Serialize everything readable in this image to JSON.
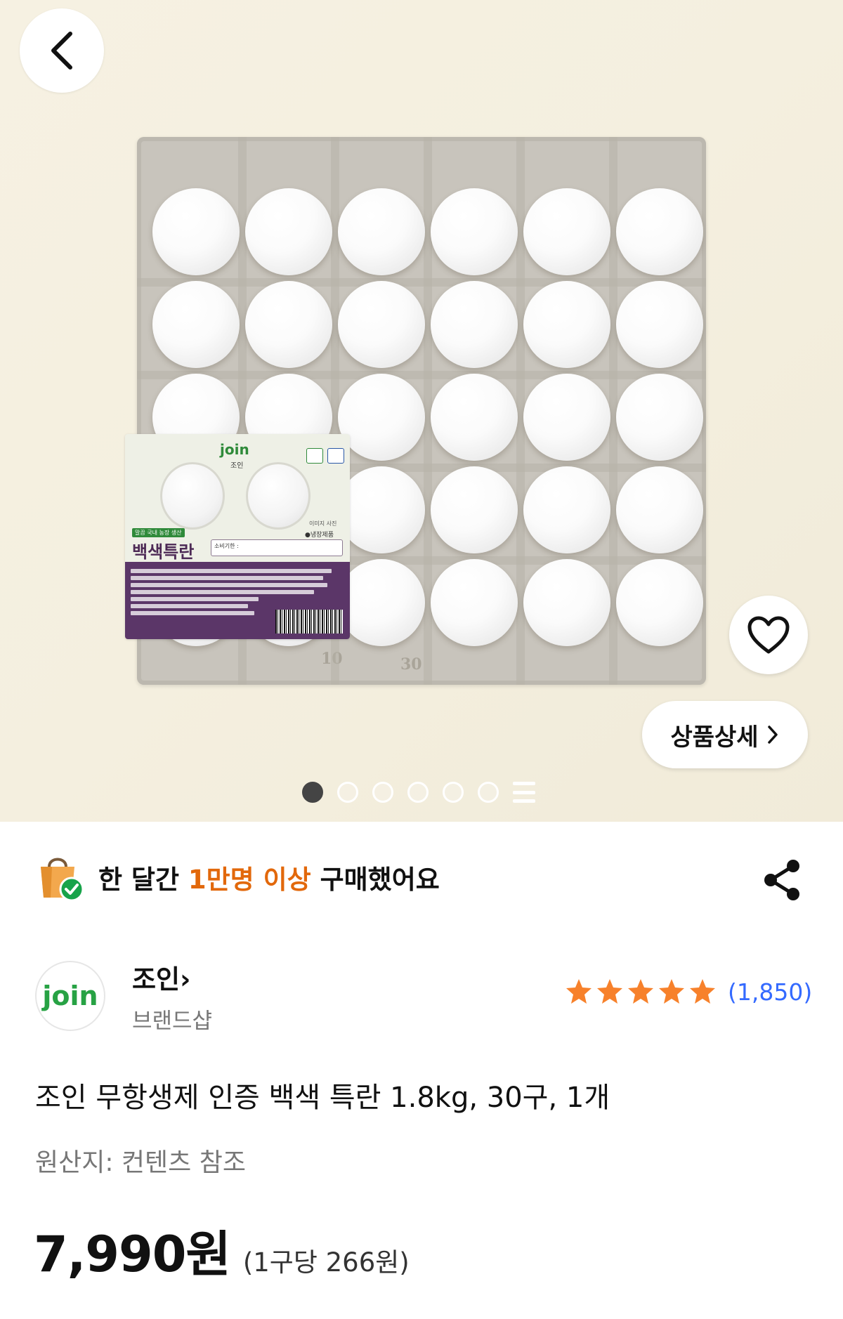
{
  "hero": {
    "label": {
      "brand": "join",
      "brand_sub": "조인",
      "ribbon": "말끔 국내 농장 생산",
      "title": "백색특란",
      "expiry": "소비기한 :",
      "photo_note": "이미지 사진",
      "fridge": "●냉장제품"
    },
    "tray_numbers": [
      "10",
      "30"
    ],
    "detail_button_label": "상품상세",
    "image_page_count": 6,
    "image_page_active": 0
  },
  "banner": {
    "prefix": "한 달간 ",
    "highlight": "1만명 이상",
    "suffix": " 구매했어요"
  },
  "brand": {
    "logo_text": "join",
    "name": "조인",
    "chevron": "›",
    "subtitle": "브랜드샵"
  },
  "rating": {
    "stars": 5,
    "count": "(1,850)"
  },
  "product": {
    "title": "조인 무항생제 인증 백색 특란 1.8kg, 30구, 1개",
    "origin": "원산지: 컨텐츠 참조"
  },
  "price": {
    "value": "7,990원",
    "unit": "(1구당 266원)"
  },
  "colors": {
    "accent": "#e2680b",
    "link": "#346aff",
    "star": "#f7812b",
    "brand_green": "#27a244"
  }
}
